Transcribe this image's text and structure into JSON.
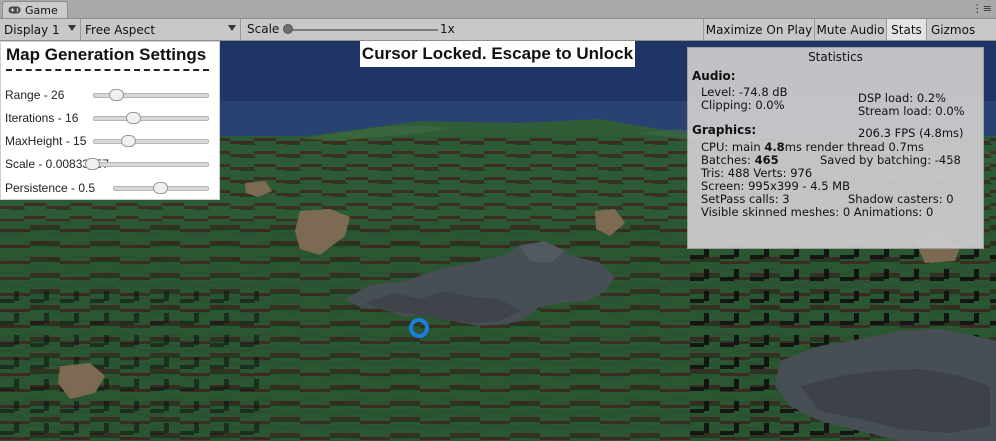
{
  "tab": {
    "label": "Game",
    "icon": "gamepad-icon",
    "menu_icon": "more-icon"
  },
  "toolbar": {
    "display": "Display 1",
    "aspect": "Free Aspect",
    "scale_label": "Scale",
    "scale_value": "1x",
    "maximize": "Maximize On Play",
    "mute": "Mute Audio",
    "stats": "Stats",
    "gizmos": "Gizmos"
  },
  "settings": {
    "title": "Map Generation Settings",
    "rows": [
      {
        "label": "Range - 26",
        "value": 0.16
      },
      {
        "label": "Iterations - 16",
        "value": 0.33
      },
      {
        "label": "MaxHeight - 15",
        "value": 0.28
      },
      {
        "label": "Scale - 0.00833557",
        "value": 0.0
      },
      {
        "label": "Persistence - 0.5",
        "value": 0.5
      }
    ]
  },
  "cursor_message": "Cursor Locked. Escape to Unlock",
  "stats": {
    "title": "Statistics",
    "audio_header": "Audio:",
    "level": "Level: -74.8 dB",
    "clipping": "Clipping: 0.0%",
    "dsp_load": "DSP load: 0.2%",
    "stream_load": "Stream load: 0.0%",
    "graphics_header": "Graphics:",
    "fps": "206.3 FPS (4.8ms)",
    "cpu_prefix": "CPU: main ",
    "cpu_main": "4.8",
    "cpu_suffix": "ms  render thread 0.7ms",
    "batches_prefix": "Batches: ",
    "batches_value": "465",
    "saved_batching": "Saved by batching: -458",
    "tris_verts": "Tris: 488  Verts: 976",
    "screen": "Screen: 995x399 - 4.5 MB",
    "setpass": "SetPass calls: 3",
    "shadow_casters": "Shadow casters: 0",
    "skinned": "Visible skinned meshes: 0  Animations: 0"
  },
  "colors": {
    "sky": "#1f3565",
    "grass": "#2c5a34",
    "grass_dark": "#1c3d22",
    "dirt": "#7c6a52",
    "rock": "#474e54",
    "reticle": "#1a7de0"
  }
}
